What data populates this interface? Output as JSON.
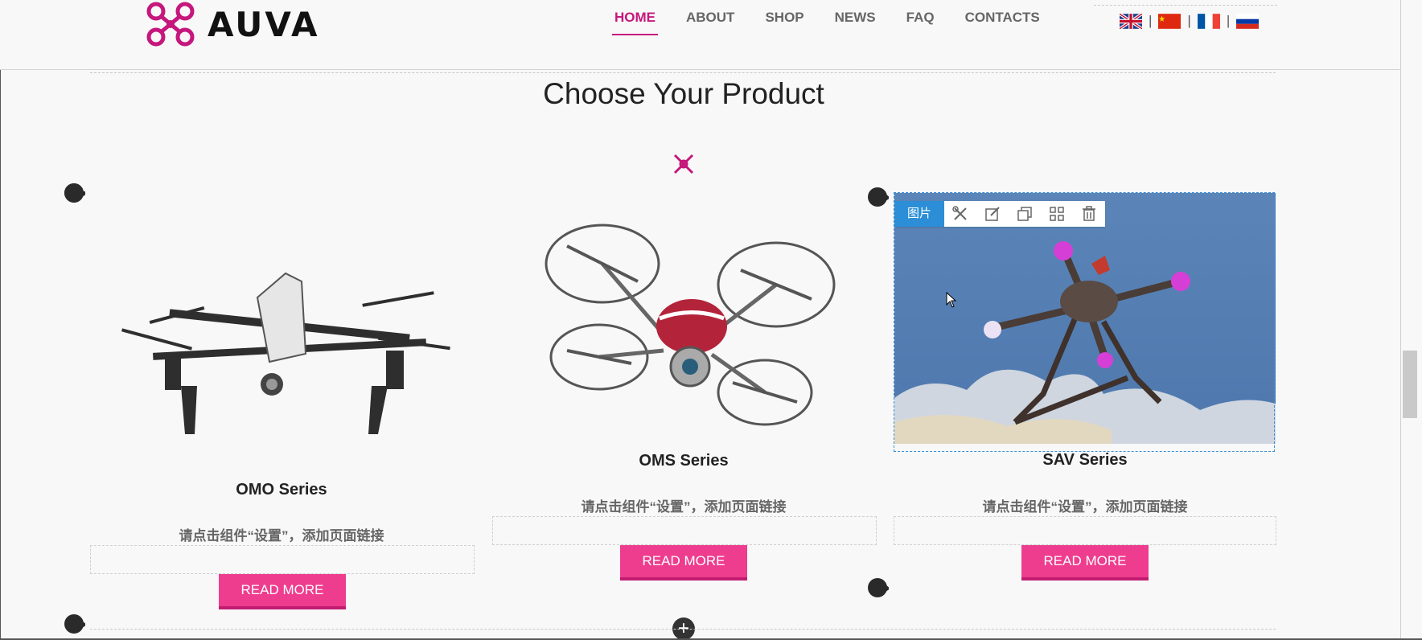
{
  "header": {
    "logo_text": "AUVA",
    "nav": [
      {
        "label": "HOME",
        "active": true
      },
      {
        "label": "ABOUT",
        "active": false
      },
      {
        "label": "SHOP",
        "active": false
      },
      {
        "label": "NEWS",
        "active": false
      },
      {
        "label": "FAQ",
        "active": false
      },
      {
        "label": "CONTACTS",
        "active": false
      }
    ],
    "languages": [
      {
        "icon": "flag-uk-icon"
      },
      {
        "icon": "flag-china-icon"
      },
      {
        "icon": "flag-france-icon"
      },
      {
        "icon": "flag-russia-icon"
      }
    ],
    "separator": "|"
  },
  "section": {
    "title": "Choose Your Product"
  },
  "products": [
    {
      "title": "OMO Series",
      "description": "请点击组件“设置”，添加页面链接",
      "button": "READ MORE"
    },
    {
      "title": "OMS Series",
      "description": "请点击组件“设置”，添加页面链接",
      "button": "READ MORE"
    },
    {
      "title": "SAV Series",
      "description": "请点击组件“设置”，添加页面链接",
      "button": "READ MORE"
    }
  ],
  "editor": {
    "toolbar_label": "图片",
    "toolbar_icons": [
      "tools-icon",
      "edit-icon",
      "copy-icon",
      "grid-icon",
      "trash-icon"
    ],
    "add_symbol": "+"
  },
  "colors": {
    "brand": "#c5177c",
    "button": "#ee3d8e",
    "editor_accent": "#2b8ed6"
  }
}
